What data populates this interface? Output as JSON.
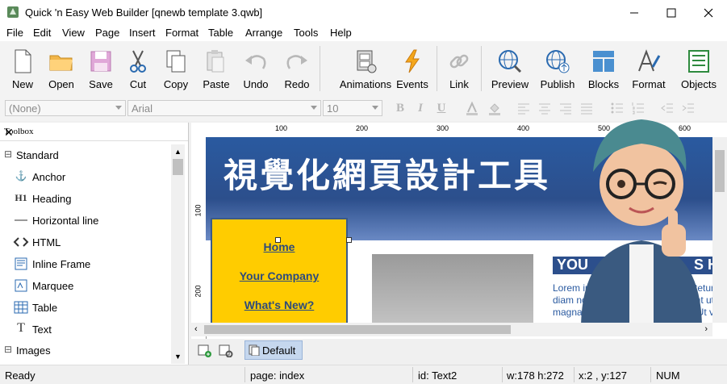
{
  "window": {
    "title": "Quick 'n Easy Web Builder [qnewb template 3.qwb]"
  },
  "menu": [
    "File",
    "Edit",
    "View",
    "Page",
    "Insert",
    "Format",
    "Table",
    "Arrange",
    "Tools",
    "Help"
  ],
  "toolbar": {
    "new": "New",
    "open": "Open",
    "save": "Save",
    "cut": "Cut",
    "copy": "Copy",
    "paste": "Paste",
    "undo": "Undo",
    "redo": "Redo",
    "animations": "Animations",
    "events": "Events",
    "link": "Link",
    "preview": "Preview",
    "publish": "Publish",
    "blocks": "Blocks",
    "format": "Format",
    "objects": "Objects"
  },
  "formatbar": {
    "style": "(None)",
    "font": "Arial",
    "size": "10"
  },
  "toolbox": {
    "title": "Toolbox",
    "groups": [
      {
        "label": "Standard"
      },
      {
        "label": "Images"
      }
    ],
    "items": [
      {
        "label": "Anchor",
        "icon": "anchor-icon"
      },
      {
        "label": "Heading",
        "icon": "heading-icon"
      },
      {
        "label": "Horizontal line",
        "icon": "horizontal-line-icon"
      },
      {
        "label": "HTML",
        "icon": "code-icon"
      },
      {
        "label": "Inline Frame",
        "icon": "iframe-icon"
      },
      {
        "label": "Marquee",
        "icon": "marquee-icon"
      },
      {
        "label": "Table",
        "icon": "table-icon"
      },
      {
        "label": "Text",
        "icon": "text-icon"
      }
    ],
    "heading_glyph": "H1",
    "text_glyph": "T"
  },
  "ruler": {
    "h": [
      "100",
      "200",
      "300",
      "400",
      "500",
      "600"
    ],
    "v": [
      "100",
      "200"
    ]
  },
  "canvas": {
    "banner_title": "視覺化網頁設計工具",
    "nav_links": [
      "Home",
      "Your Company",
      "What's New?"
    ],
    "section_heading": "YOU",
    "section_heading_tail": "S H",
    "lorem_lines": [
      "Lorem ip",
      "diam no",
      "magna"
    ],
    "lorem_tail": [
      "ectetur",
      "vidunt ut",
      "t. Ut v"
    ]
  },
  "pagetabs": {
    "default_label": "Default"
  },
  "status": {
    "state": "Ready",
    "page": "page: index",
    "id": "id: Text2",
    "size": "w:178 h:272",
    "pos": "x:2 , y:127",
    "num": "NUM"
  },
  "colors": {
    "banner_blue": "#2c4f8c",
    "nav_yellow": "#ffcc00",
    "link_blue": "#2c4a7c"
  }
}
